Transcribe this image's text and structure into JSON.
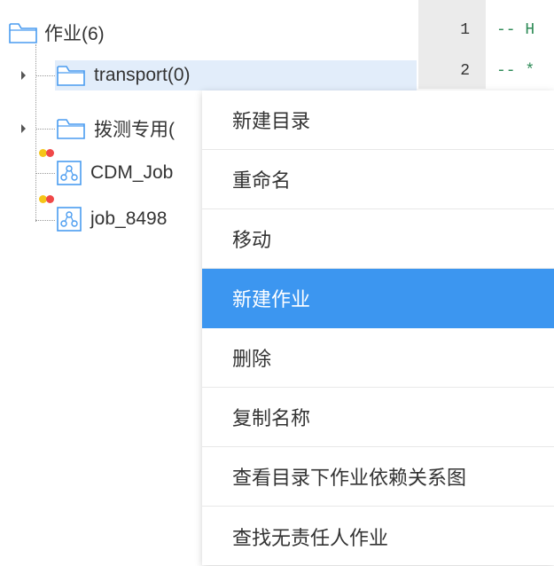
{
  "tree": {
    "root": {
      "label": "作业(6)",
      "icon": "folder-icon"
    },
    "children": [
      {
        "label": "transport(0)",
        "icon": "folder-icon",
        "selected": true
      },
      {
        "label": "拨测专用(",
        "icon": "folder-icon"
      },
      {
        "label": "CDM_Job",
        "icon": "job-icon",
        "status_colors": [
          "#f5c518",
          "#f04848"
        ]
      },
      {
        "label": "job_8498",
        "icon": "job-icon",
        "status_colors": [
          "#f5c518",
          "#f04848"
        ]
      }
    ]
  },
  "editor": {
    "lines": [
      {
        "number": "1",
        "code": "-- H"
      },
      {
        "number": "2",
        "code": "-- *"
      }
    ]
  },
  "context_menu": {
    "items": [
      {
        "label": "新建目录"
      },
      {
        "label": "重命名"
      },
      {
        "label": "移动"
      },
      {
        "label": "新建作业",
        "highlighted": true
      },
      {
        "label": "删除"
      },
      {
        "label": "复制名称"
      },
      {
        "label": "查看目录下作业依赖关系图"
      },
      {
        "label": "查找无责任人作业"
      }
    ]
  },
  "colors": {
    "accent": "#3c96f0",
    "selection": "#e2edfa",
    "folder": "#4a9cf0"
  }
}
